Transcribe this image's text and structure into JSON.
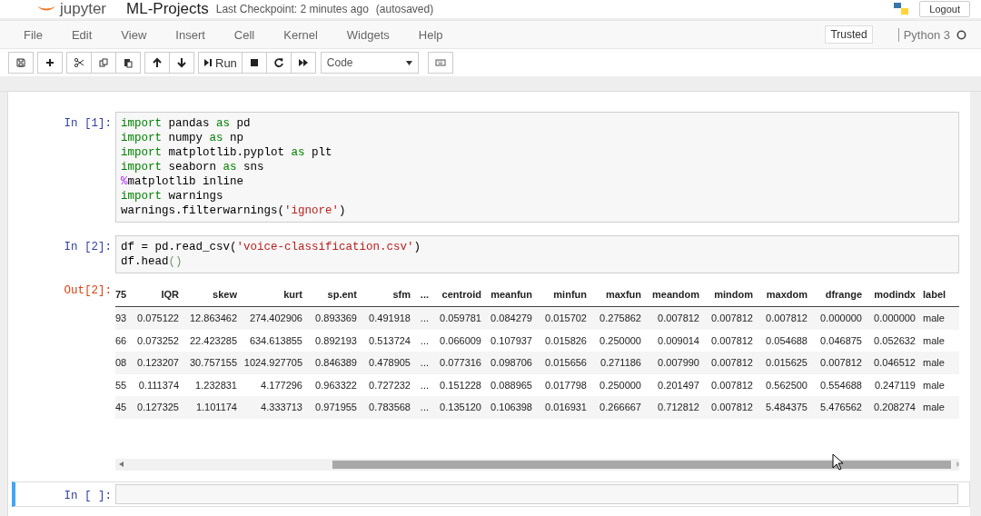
{
  "header": {
    "logo_text": "jupyter",
    "notebook_name": "ML-Projects",
    "checkpoint": "Last Checkpoint: 2 minutes ago",
    "autosave": "(autosaved)",
    "logout": "Logout"
  },
  "menu": {
    "items": [
      "File",
      "Edit",
      "View",
      "Insert",
      "Cell",
      "Kernel",
      "Widgets",
      "Help"
    ],
    "trusted": "Trusted",
    "kernel": "Python 3"
  },
  "toolbar": {
    "run_label": "Run",
    "cell_type": "Code"
  },
  "cells": [
    {
      "prompt": "In [1]:",
      "selected": false,
      "lines": [
        [
          {
            "kind": "keyword",
            "text": "import"
          },
          {
            "kind": "plain",
            "text": " pandas "
          },
          {
            "kind": "keyword",
            "text": "as"
          },
          {
            "kind": "plain",
            "text": " pd"
          }
        ],
        [
          {
            "kind": "keyword",
            "text": "import"
          },
          {
            "kind": "plain",
            "text": " numpy "
          },
          {
            "kind": "keyword",
            "text": "as"
          },
          {
            "kind": "plain",
            "text": " np"
          }
        ],
        [
          {
            "kind": "keyword",
            "text": "import"
          },
          {
            "kind": "plain",
            "text": " matplotlib.pyplot "
          },
          {
            "kind": "keyword",
            "text": "as"
          },
          {
            "kind": "plain",
            "text": " plt"
          }
        ],
        [
          {
            "kind": "keyword",
            "text": "import"
          },
          {
            "kind": "plain",
            "text": " seaborn "
          },
          {
            "kind": "keyword",
            "text": "as"
          },
          {
            "kind": "plain",
            "text": " sns"
          }
        ],
        [
          {
            "kind": "magic",
            "text": "%"
          },
          {
            "kind": "plain",
            "text": "matplotlib inline"
          }
        ],
        [
          {
            "kind": "keyword",
            "text": "import"
          },
          {
            "kind": "plain",
            "text": " warnings"
          }
        ],
        [
          {
            "kind": "plain",
            "text": "warnings.filterwarnings("
          },
          {
            "kind": "string",
            "text": "'ignore'"
          },
          {
            "kind": "plain",
            "text": ")"
          }
        ]
      ]
    },
    {
      "prompt": "In [2]:",
      "selected": false,
      "lines": [
        [
          {
            "kind": "plain",
            "text": "df = pd.read_csv("
          },
          {
            "kind": "string",
            "text": "'voice-classification.csv'"
          },
          {
            "kind": "plain",
            "text": ")"
          }
        ],
        [
          {
            "kind": "plain",
            "text": "df.head"
          },
          {
            "kind": "paren",
            "text": "()"
          }
        ]
      ],
      "output": {
        "prompt": "Out[2]:",
        "table": {
          "columns": [
            "75",
            "IQR",
            "skew",
            "kurt",
            "sp.ent",
            "sfm",
            "...",
            "centroid",
            "meanfun",
            "minfun",
            "maxfun",
            "meandom",
            "mindom",
            "maxdom",
            "dfrange",
            "modindx",
            "label"
          ],
          "rows": [
            [
              "93",
              "0.075122",
              "12.863462",
              "274.402906",
              "0.893369",
              "0.491918",
              "...",
              "0.059781",
              "0.084279",
              "0.015702",
              "0.275862",
              "0.007812",
              "0.007812",
              "0.007812",
              "0.000000",
              "0.000000",
              "male"
            ],
            [
              "66",
              "0.073252",
              "22.423285",
              "634.613855",
              "0.892193",
              "0.513724",
              "...",
              "0.066009",
              "0.107937",
              "0.015826",
              "0.250000",
              "0.009014",
              "0.007812",
              "0.054688",
              "0.046875",
              "0.052632",
              "male"
            ],
            [
              "08",
              "0.123207",
              "30.757155",
              "1024.927705",
              "0.846389",
              "0.478905",
              "...",
              "0.077316",
              "0.098706",
              "0.015656",
              "0.271186",
              "0.007990",
              "0.007812",
              "0.015625",
              "0.007812",
              "0.046512",
              "male"
            ],
            [
              "55",
              "0.111374",
              "1.232831",
              "4.177296",
              "0.963322",
              "0.727232",
              "...",
              "0.151228",
              "0.088965",
              "0.017798",
              "0.250000",
              "0.201497",
              "0.007812",
              "0.562500",
              "0.554688",
              "0.247119",
              "male"
            ],
            [
              "45",
              "0.127325",
              "1.101174",
              "4.333713",
              "0.971955",
              "0.783568",
              "...",
              "0.135120",
              "0.106398",
              "0.016931",
              "0.266667",
              "0.712812",
              "0.007812",
              "5.484375",
              "5.476562",
              "0.208274",
              "male"
            ]
          ]
        }
      }
    },
    {
      "prompt": "In [ ]:",
      "selected": true
    }
  ]
}
